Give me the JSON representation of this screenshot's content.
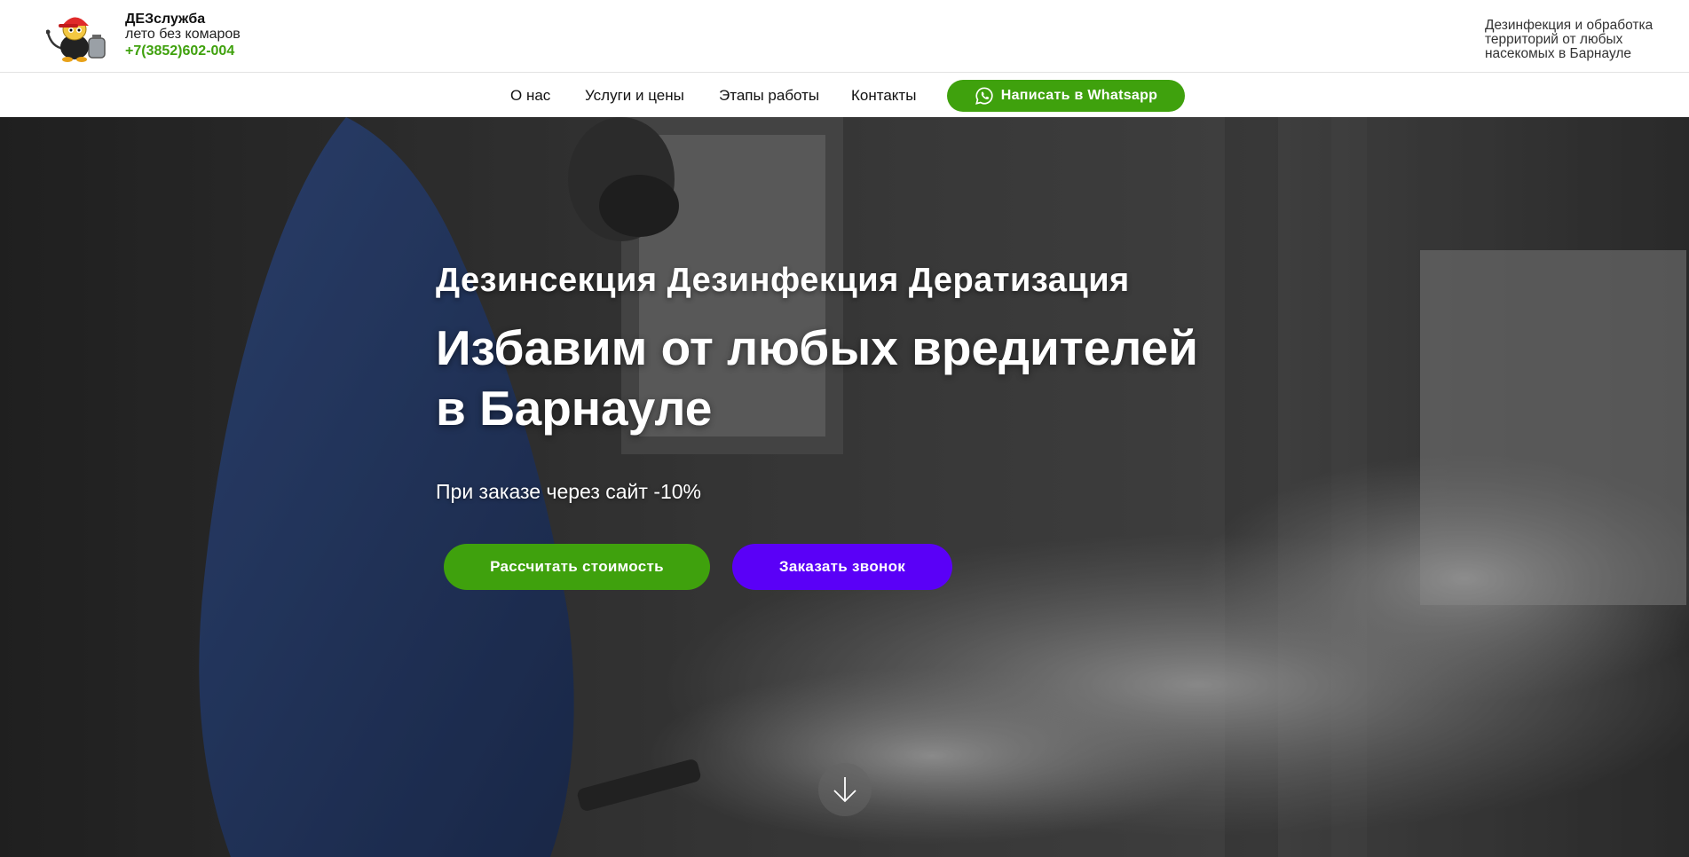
{
  "header": {
    "brand_name": "ДЕЗслужба",
    "slogan": "лето без комаров",
    "phone": "+7(3852)602-004",
    "description": "Дезинфекция и обработка территорий от любых насекомых в Барнауле",
    "logo_icon": "exterminator-mascot-icon"
  },
  "nav": {
    "items": [
      {
        "label": "О нас"
      },
      {
        "label": "Услуги и цены"
      },
      {
        "label": "Этапы работы"
      },
      {
        "label": "Контакты"
      }
    ],
    "whatsapp_label": "Написать в Whatsapp",
    "whatsapp_icon": "whatsapp-icon"
  },
  "hero": {
    "supertitle": "Дезинсекция Дезинфекция Дератизация",
    "title": "Избавим от любых вредителей в Барнауле",
    "subtitle": "При заказе через сайт -10%",
    "calc_button": "Рассчитать стоимость",
    "call_button": "Заказать звонок",
    "scroll_icon": "arrow-down-icon"
  },
  "colors": {
    "accent_green": "#3fa10d",
    "accent_purple": "#5a00f7",
    "text_dark": "#111111"
  }
}
